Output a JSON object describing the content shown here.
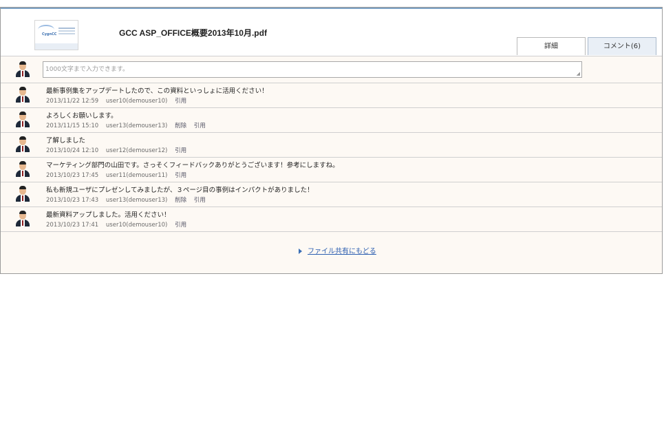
{
  "file": {
    "title": "GCC ASP_OFFICE概要2013年10月.pdf",
    "thumb_logo": "CygnCC"
  },
  "tabs": {
    "detail": "詳細",
    "comment": "コメント(6)"
  },
  "input": {
    "placeholder": "1000文字まで入力できます。"
  },
  "comments": [
    {
      "text": "最新事例集をアップデートしたので、この資料といっしょに活用ください！",
      "date": "2013/11/22 12:59",
      "user": "user10(demouser10)",
      "delete": "",
      "quote": "引用"
    },
    {
      "text": "よろしくお願いします。",
      "date": "2013/11/15 15:10",
      "user": "user13(demouser13)",
      "delete": "削除",
      "quote": "引用"
    },
    {
      "text": "了解しました",
      "date": "2013/10/24 12:10",
      "user": "user12(demouser12)",
      "delete": "",
      "quote": "引用"
    },
    {
      "text": "マーケティング部門の山田です。さっそくフィードバックありがとうございます！参考にしますね。",
      "date": "2013/10/23 17:45",
      "user": "user11(demouser11)",
      "delete": "",
      "quote": "引用"
    },
    {
      "text": "私も新規ユーザにプレゼンしてみましたが、３ページ目の事例はインパクトがありました！",
      "date": "2013/10/23 17:43",
      "user": "user13(demouser13)",
      "delete": "削除",
      "quote": "引用"
    },
    {
      "text": "最新資料アップしました。活用ください！",
      "date": "2013/10/23 17:41",
      "user": "user10(demouser10)",
      "delete": "",
      "quote": "引用"
    }
  ],
  "footer": {
    "back_link": "ファイル共有にもどる"
  }
}
